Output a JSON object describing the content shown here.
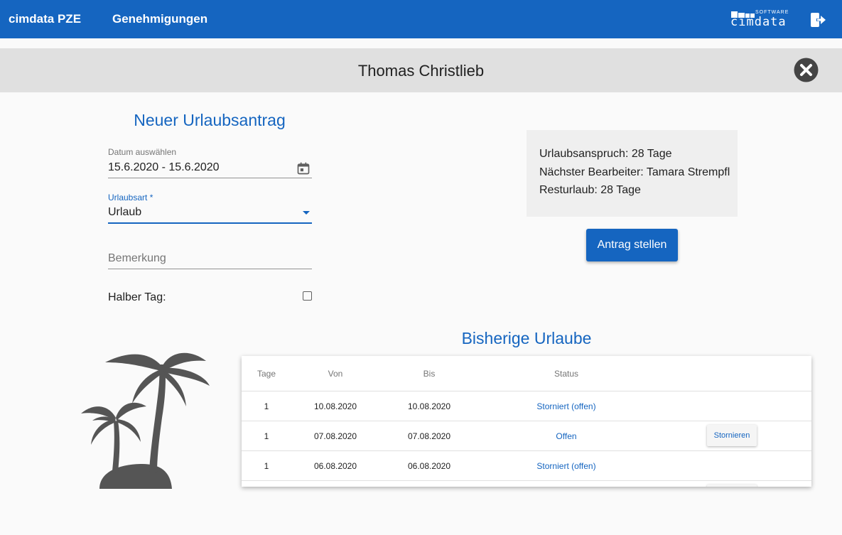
{
  "topbar": {
    "brand": "cimdata PZE",
    "nav_label": "Genehmigungen",
    "logo_software": "SOFTWARE",
    "logo_word": "cimdata",
    "exit_icon": "exit-icon",
    "color": "#1565c0"
  },
  "namebar": {
    "name": "Thomas Christlieb",
    "close_icon": "close-circle-icon"
  },
  "form": {
    "title": "Neuer Urlaubsantrag",
    "date_label": "Datum auswählen",
    "date_value": "15.6.2020 - 15.6.2020",
    "type_label": "Urlaubsart *",
    "type_value": "Urlaub",
    "remark_placeholder": "Bemerkung",
    "half_day_label": "Halber Tag:",
    "half_day_checked": false
  },
  "info": {
    "line1": "Urlaubsanspruch: 28 Tage",
    "line2": "Nächster Bearbeiter: Tamara Strempfl",
    "line3": "Resturlaub: 28 Tage"
  },
  "submit_label": "Antrag stellen",
  "history": {
    "title": "Bisherige Urlaube",
    "illustration_icon": "palm-tree-icon",
    "columns": [
      "Tage",
      "Von",
      "Bis",
      "Status"
    ],
    "rows": [
      {
        "tage": "1",
        "von": "10.08.2020",
        "bis": "10.08.2020",
        "status": "Storniert (offen)",
        "action": ""
      },
      {
        "tage": "1",
        "von": "07.08.2020",
        "bis": "07.08.2020",
        "status": "Offen",
        "action": "Stornieren"
      },
      {
        "tage": "1",
        "von": "06.08.2020",
        "bis": "06.08.2020",
        "status": "Storniert (offen)",
        "action": ""
      }
    ]
  }
}
